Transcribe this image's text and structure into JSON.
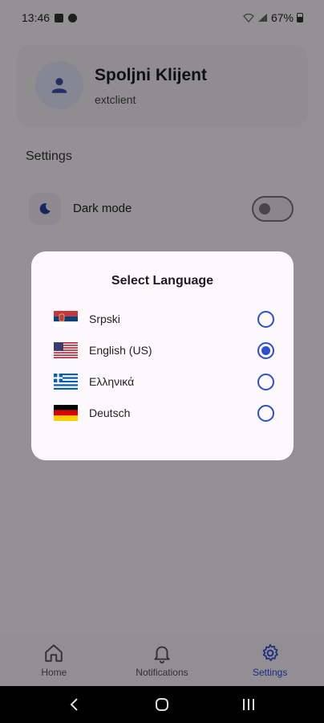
{
  "status_bar": {
    "time": "13:46",
    "battery": "67%"
  },
  "profile": {
    "name": "Spoljni Klijent",
    "username": "extclient"
  },
  "settings": {
    "heading": "Settings",
    "dark_mode_label": "Dark mode",
    "dark_mode_on": false
  },
  "dialog": {
    "title": "Select Language",
    "options": [
      {
        "label": "Srpski",
        "flag": "serbia-flag",
        "selected": false
      },
      {
        "label": "English (US)",
        "flag": "us-flag",
        "selected": true
      },
      {
        "label": "Ελληνικά",
        "flag": "greece-flag",
        "selected": false
      },
      {
        "label": "Deutsch",
        "flag": "germany-flag",
        "selected": false
      }
    ]
  },
  "bottom_nav": {
    "items": [
      {
        "label": "Home",
        "icon": "home-icon",
        "active": false
      },
      {
        "label": "Notifications",
        "icon": "bell-icon",
        "active": false
      },
      {
        "label": "Settings",
        "icon": "gear-icon",
        "active": true
      }
    ]
  },
  "colors": {
    "accent": "#2a4fd1",
    "scrim": "rgba(0,0,0,0.40)"
  }
}
